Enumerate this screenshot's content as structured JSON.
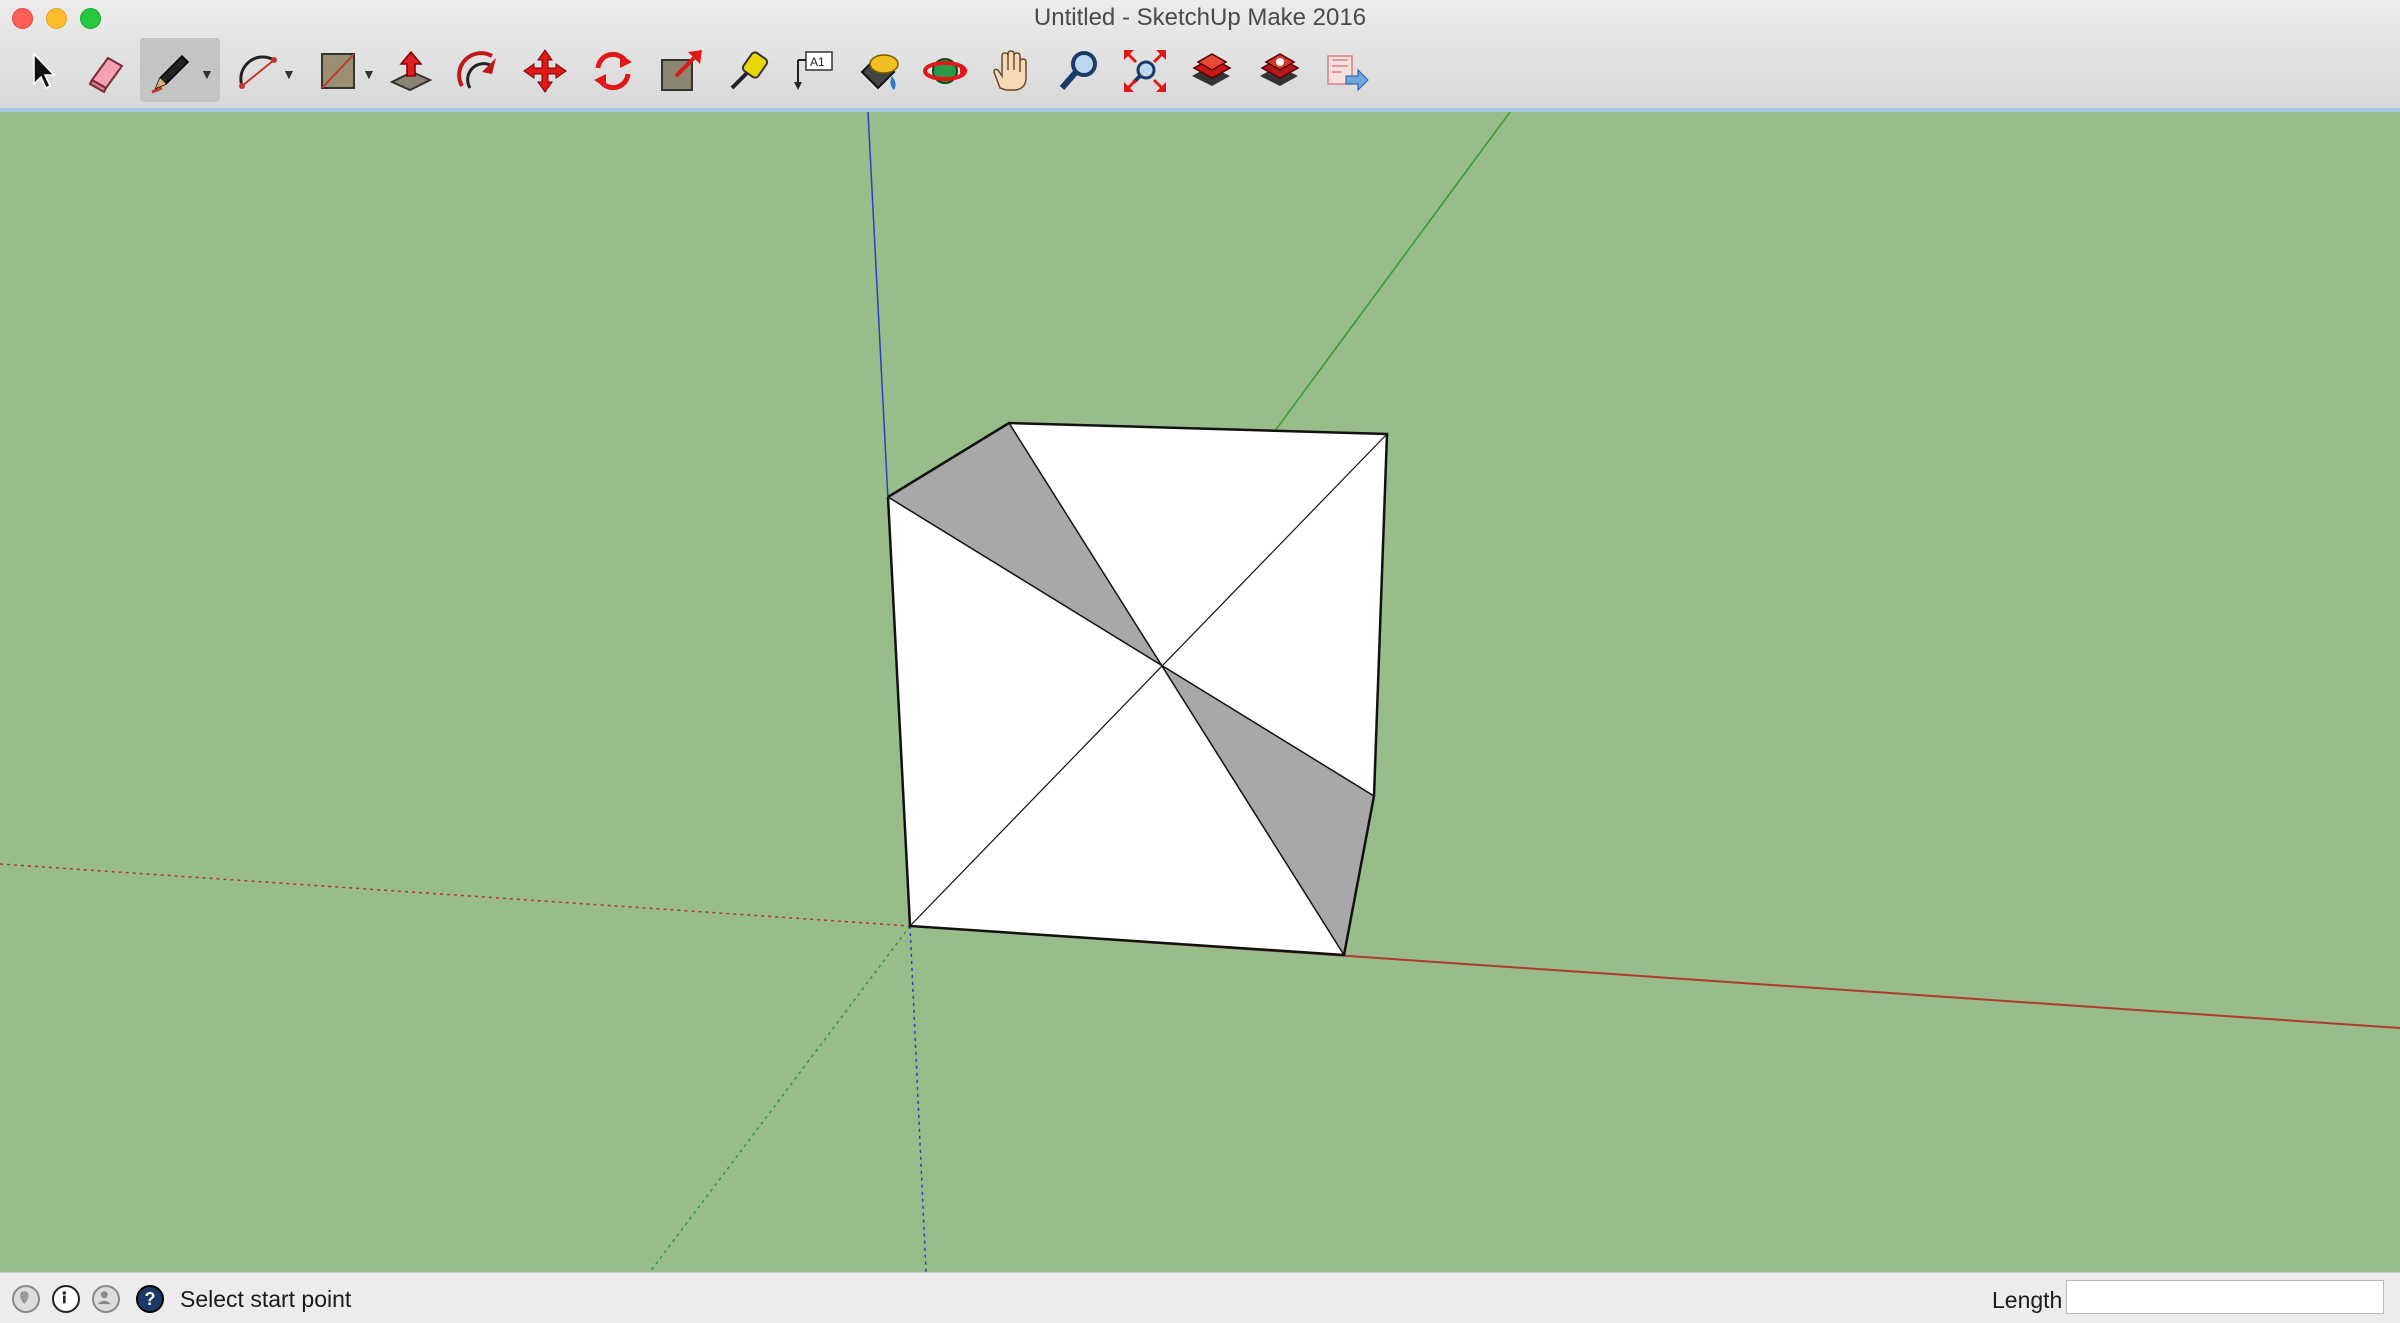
{
  "window": {
    "title": "Untitled - SketchUp Make 2016",
    "controls": [
      "close",
      "minimize",
      "zoom"
    ]
  },
  "toolbar": {
    "tools": [
      {
        "name": "select-tool",
        "icon": "arrow-cursor-icon"
      },
      {
        "name": "eraser-tool",
        "icon": "eraser-icon"
      },
      {
        "name": "line-tool",
        "icon": "pencil-icon",
        "active": true,
        "has_dropdown": true
      },
      {
        "name": "arc-tool",
        "icon": "arc-icon",
        "has_dropdown": true
      },
      {
        "name": "rectangle-tool",
        "icon": "rectangle-icon",
        "has_dropdown": true
      },
      {
        "name": "push-pull-tool",
        "icon": "push-pull-icon"
      },
      {
        "name": "offset-tool",
        "icon": "offset-icon"
      },
      {
        "name": "move-tool",
        "icon": "move-arrows-icon"
      },
      {
        "name": "rotate-tool",
        "icon": "rotate-icon"
      },
      {
        "name": "scale-tool",
        "icon": "scale-icon"
      },
      {
        "name": "tape-measure-tool",
        "icon": "tape-measure-icon"
      },
      {
        "name": "text-tool",
        "icon": "text-label-icon",
        "label": "A1"
      },
      {
        "name": "paint-bucket-tool",
        "icon": "paint-bucket-icon"
      },
      {
        "name": "orbit-tool",
        "icon": "orbit-icon"
      },
      {
        "name": "pan-tool",
        "icon": "hand-icon"
      },
      {
        "name": "zoom-tool",
        "icon": "magnifier-icon"
      },
      {
        "name": "zoom-extents-tool",
        "icon": "zoom-extents-icon"
      },
      {
        "name": "3d-warehouse-tool",
        "icon": "warehouse-icon"
      },
      {
        "name": "extension-warehouse-tool",
        "icon": "extension-warehouse-icon"
      },
      {
        "name": "share-model-tool",
        "icon": "share-model-icon"
      }
    ]
  },
  "colors": {
    "ground": "#98bd8b",
    "red_axis": "#b03a2e",
    "green_axis": "#2f9a2f",
    "blue_axis": "#2a3fbf",
    "face_front": "#ffffff",
    "face_back": "#a8a8a8",
    "edge": "#000000",
    "active_tool_bg": "#c4c4c4"
  },
  "status": {
    "icons": [
      "geo-location-icon",
      "credits-icon",
      "user-account-icon",
      "help-icon"
    ],
    "prompt": "Select start point",
    "measurement_label": "Length",
    "measurement_value": ""
  }
}
